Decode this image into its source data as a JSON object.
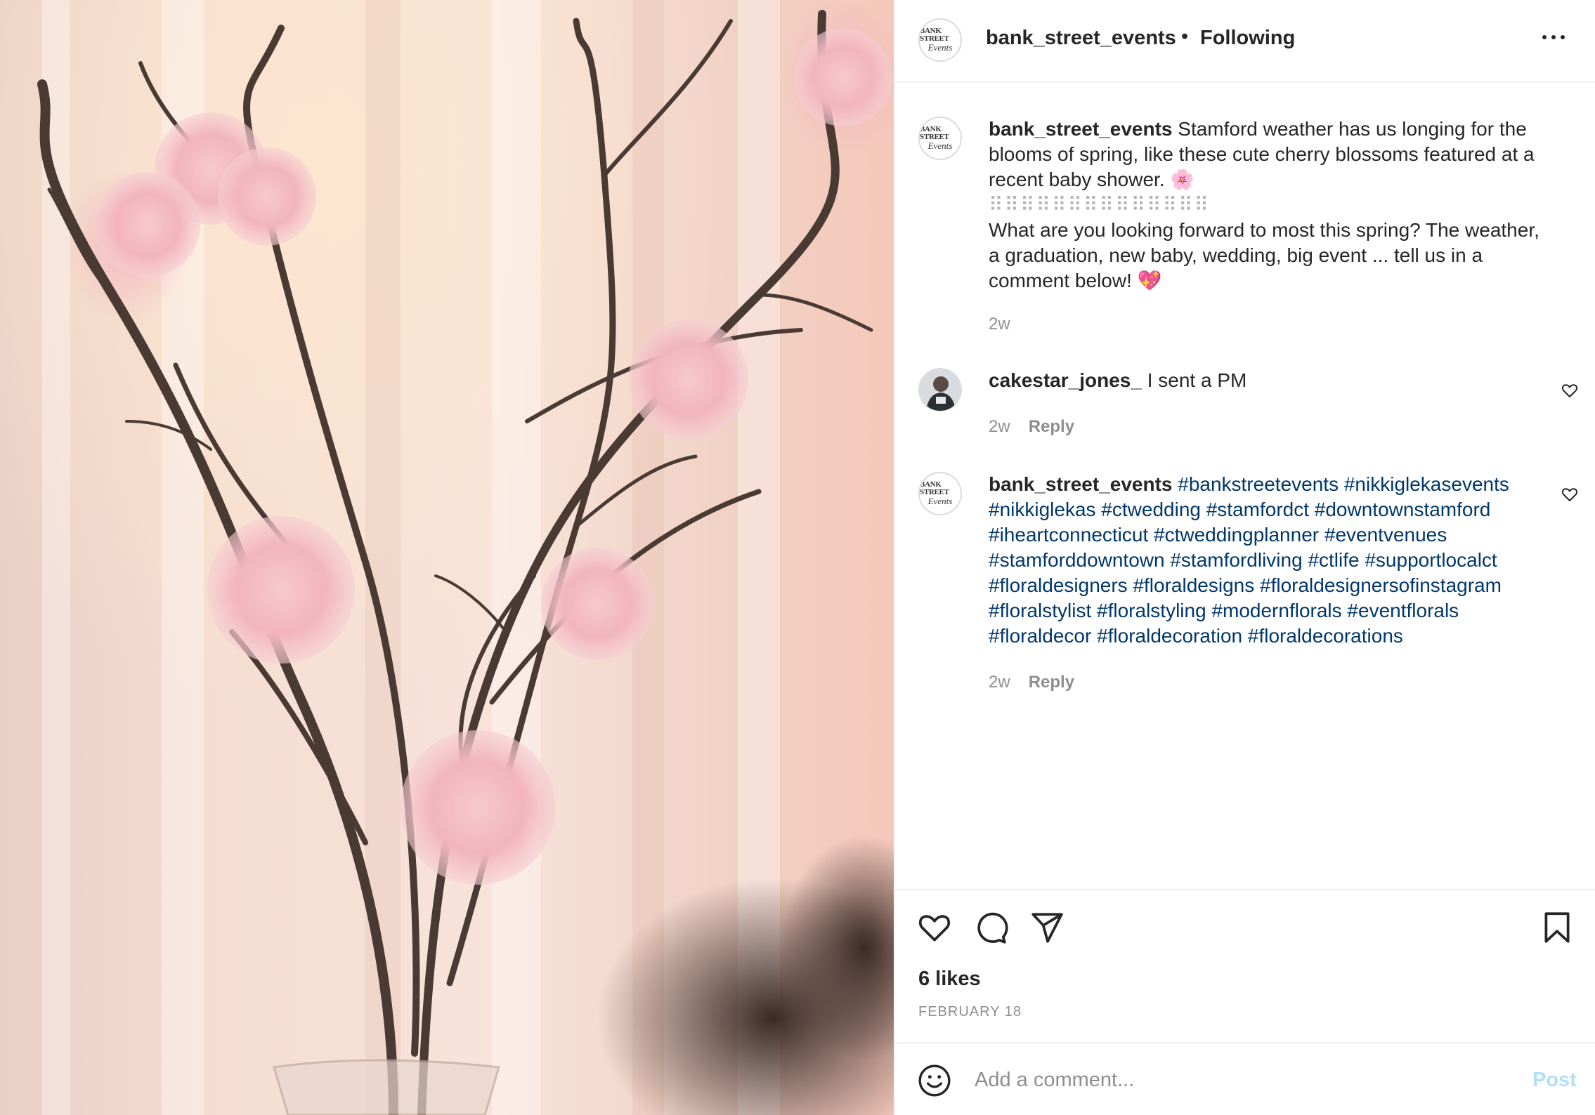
{
  "post": {
    "username": "bank_street_events",
    "separator": "•",
    "follow_status": "Following",
    "logo_line1": "BANK STREET",
    "logo_line2": "Events"
  },
  "caption": {
    "username": "bank_street_events",
    "text_line1": " Stamford weather has us longing for the blooms of spring, like these cute cherry blossoms featured at a recent baby shower. 🌸",
    "divider": "⠿⠿⠿⠿⠿⠿⠿⠿⠿⠿⠿⠿⠿⠿",
    "text_line2": "What are you looking forward to most this spring? The weather, a graduation, new baby, wedding, big event ... tell us in a comment below! 💖",
    "time": "2w"
  },
  "comments": [
    {
      "username": "cakestar_jones_",
      "text": " I sent a PM",
      "time": "2w",
      "reply_label": "Reply"
    },
    {
      "username": "bank_street_events",
      "hashtags": "#bankstreetevents #nikkiglekasevents #nikkiglekas #ctwedding #stamfordct #downtownstamford #iheartconnecticut #ctweddingplanner #eventvenues #stamforddowntown #stamfordliving #ctlife #supportlocalct #floraldesigners #floraldesigns #floraldesignersofinstagram #floralstylist #floralstyling #modernflorals #eventflorals #floraldecor #floraldecoration #floraldecorations",
      "time": "2w",
      "reply_label": "Reply"
    }
  ],
  "engagement": {
    "likes": "6 likes",
    "date": "FEBRUARY 18"
  },
  "add_comment": {
    "placeholder": "Add a comment...",
    "post_label": "Post"
  },
  "colors": {
    "hashtag": "#00376b",
    "muted": "#8e8e8e",
    "post_button": "#b2dffc",
    "text": "#262626"
  },
  "icons": [
    "more-options-icon",
    "heart-icon",
    "comment-icon",
    "share-icon",
    "bookmark-icon",
    "emoji-icon",
    "small-heart-icon"
  ]
}
